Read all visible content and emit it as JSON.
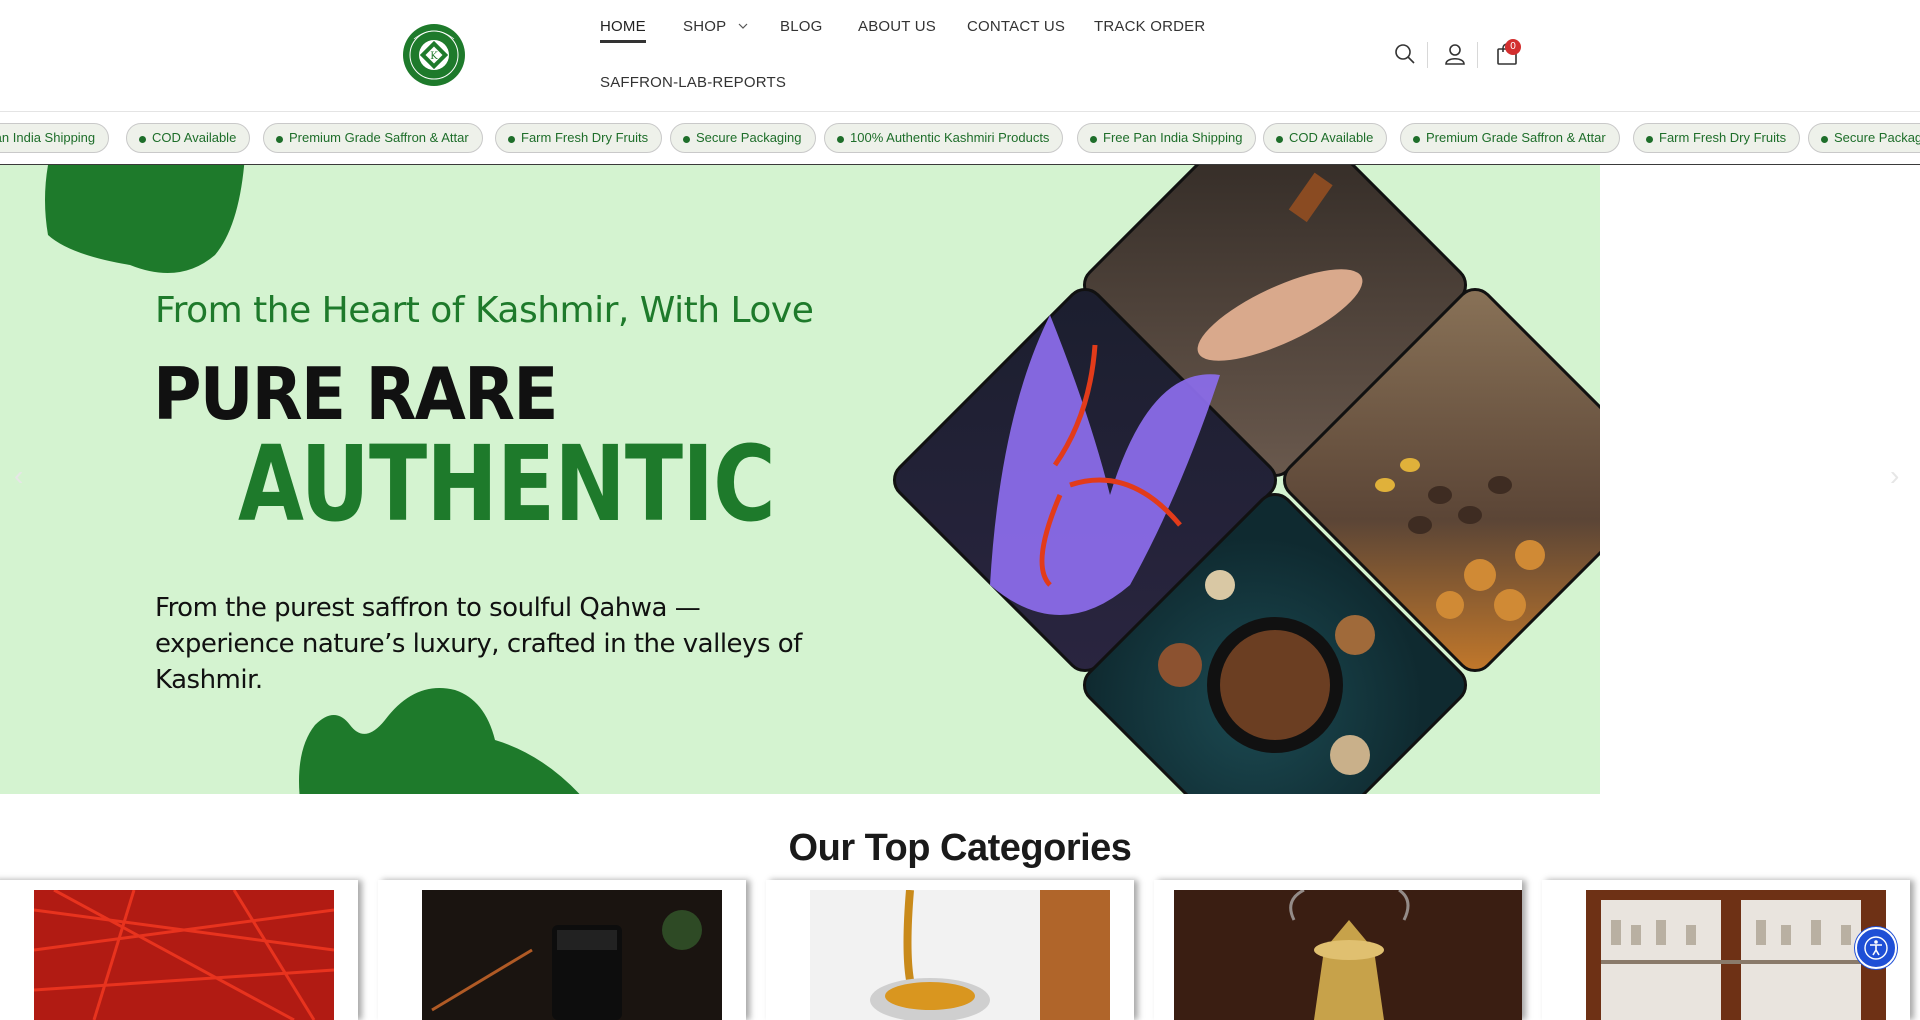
{
  "header": {
    "logo_alt": "KASHMIR CART",
    "nav": [
      {
        "label": "HOME"
      },
      {
        "label": "SHOP"
      },
      {
        "label": "BLOG"
      },
      {
        "label": "ABOUT US"
      },
      {
        "label": "CONTACT US"
      },
      {
        "label": "TRACK ORDER"
      },
      {
        "label": "SAFFRON-LAB-REPORTS"
      }
    ],
    "cart_count": "0",
    "icons": [
      "search-icon",
      "user-icon",
      "cart-icon",
      "chevron-down-icon"
    ]
  },
  "ticker": {
    "items": [
      "Pan India Shipping",
      "COD Available",
      "Premium Grade Saffron & Attar",
      "Farm Fresh Dry Fruits",
      "Secure Packaging",
      "100% Authentic Kashmiri Products",
      "Free Pan India Shipping",
      "COD Available",
      "Premium Grade Saffron & Attar",
      "Farm Fresh Dry Fruits",
      "Secure Packagi"
    ]
  },
  "hero": {
    "subtitle": "From the Heart of Kashmir, With Love",
    "title_line1": "PURE RARE",
    "title_line2": "AUTHENTIC",
    "description": "From the purest saffron to soulful Qahwa — experience nature’s luxury, crafted in the valleys of Kashmir.",
    "prev_arrow": "‹",
    "next_arrow": "›",
    "colors": {
      "background": "#d4f3d0",
      "accent": "#1e7a2b"
    }
  },
  "categories": {
    "title": "Our Top Categories"
  }
}
